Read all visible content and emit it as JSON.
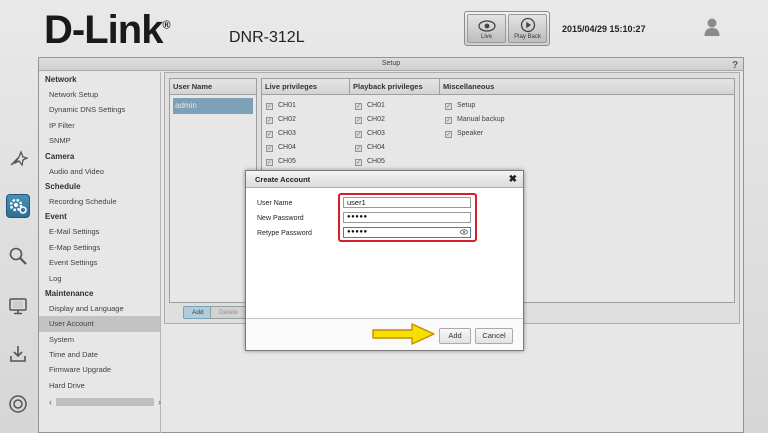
{
  "header": {
    "brand": "D-Link",
    "brand_mark": "®",
    "model": "DNR-312L",
    "datetime": "2015/04/29 15:10:27",
    "live_label": "Live",
    "playback_label": "Play Back"
  },
  "panel": {
    "title": "Setup"
  },
  "sidebar": {
    "sections": [
      {
        "title": "Network",
        "items": [
          "Network Setup",
          "Dynamic DNS Settings",
          "IP Filter",
          "SNMP"
        ]
      },
      {
        "title": "Camera",
        "items": [
          "Audio and Video"
        ]
      },
      {
        "title": "Schedule",
        "items": [
          "Recording Schedule"
        ]
      },
      {
        "title": "Event",
        "items": [
          "E-Mail Settings",
          "E-Map Settings",
          "Event Settings",
          "Log"
        ]
      },
      {
        "title": "Maintenance",
        "items": [
          "Display and Language",
          "User Account",
          "System",
          "Time and Date",
          "Firmware Upgrade",
          "Hard Drive"
        ]
      }
    ],
    "active_item": "User Account",
    "scroll_left": "‹",
    "scroll_right": "›"
  },
  "users": {
    "header": "User Name",
    "rows": [
      "admin"
    ],
    "add_label": "Add",
    "delete_label": "Delete"
  },
  "privileges": {
    "live_header": "Live privileges",
    "playback_header": "Playback privileges",
    "misc_header": "Miscellaneous",
    "live_channels": [
      "CH01",
      "CH02",
      "CH03",
      "CH04",
      "CH05"
    ],
    "playback_channels": [
      "CH01",
      "CH02",
      "CH03",
      "CH04",
      "CH05"
    ],
    "misc_items": [
      "Setup",
      "Manual backup",
      "Speaker"
    ]
  },
  "modal": {
    "title": "Create Account",
    "close": "✖",
    "fields": {
      "username_label": "User Name",
      "username_value": "user1",
      "new_password_label": "New Password",
      "new_password_value": "●●●●●",
      "retype_password_label": "Retype Password",
      "retype_password_value": "●●●●●"
    },
    "add_label": "Add",
    "cancel_label": "Cancel"
  },
  "colors": {
    "highlight": "#d81e2a",
    "arrow": "#f5e000",
    "selected_row": "#7ea9c7",
    "active_rail": "#2b6f93"
  }
}
